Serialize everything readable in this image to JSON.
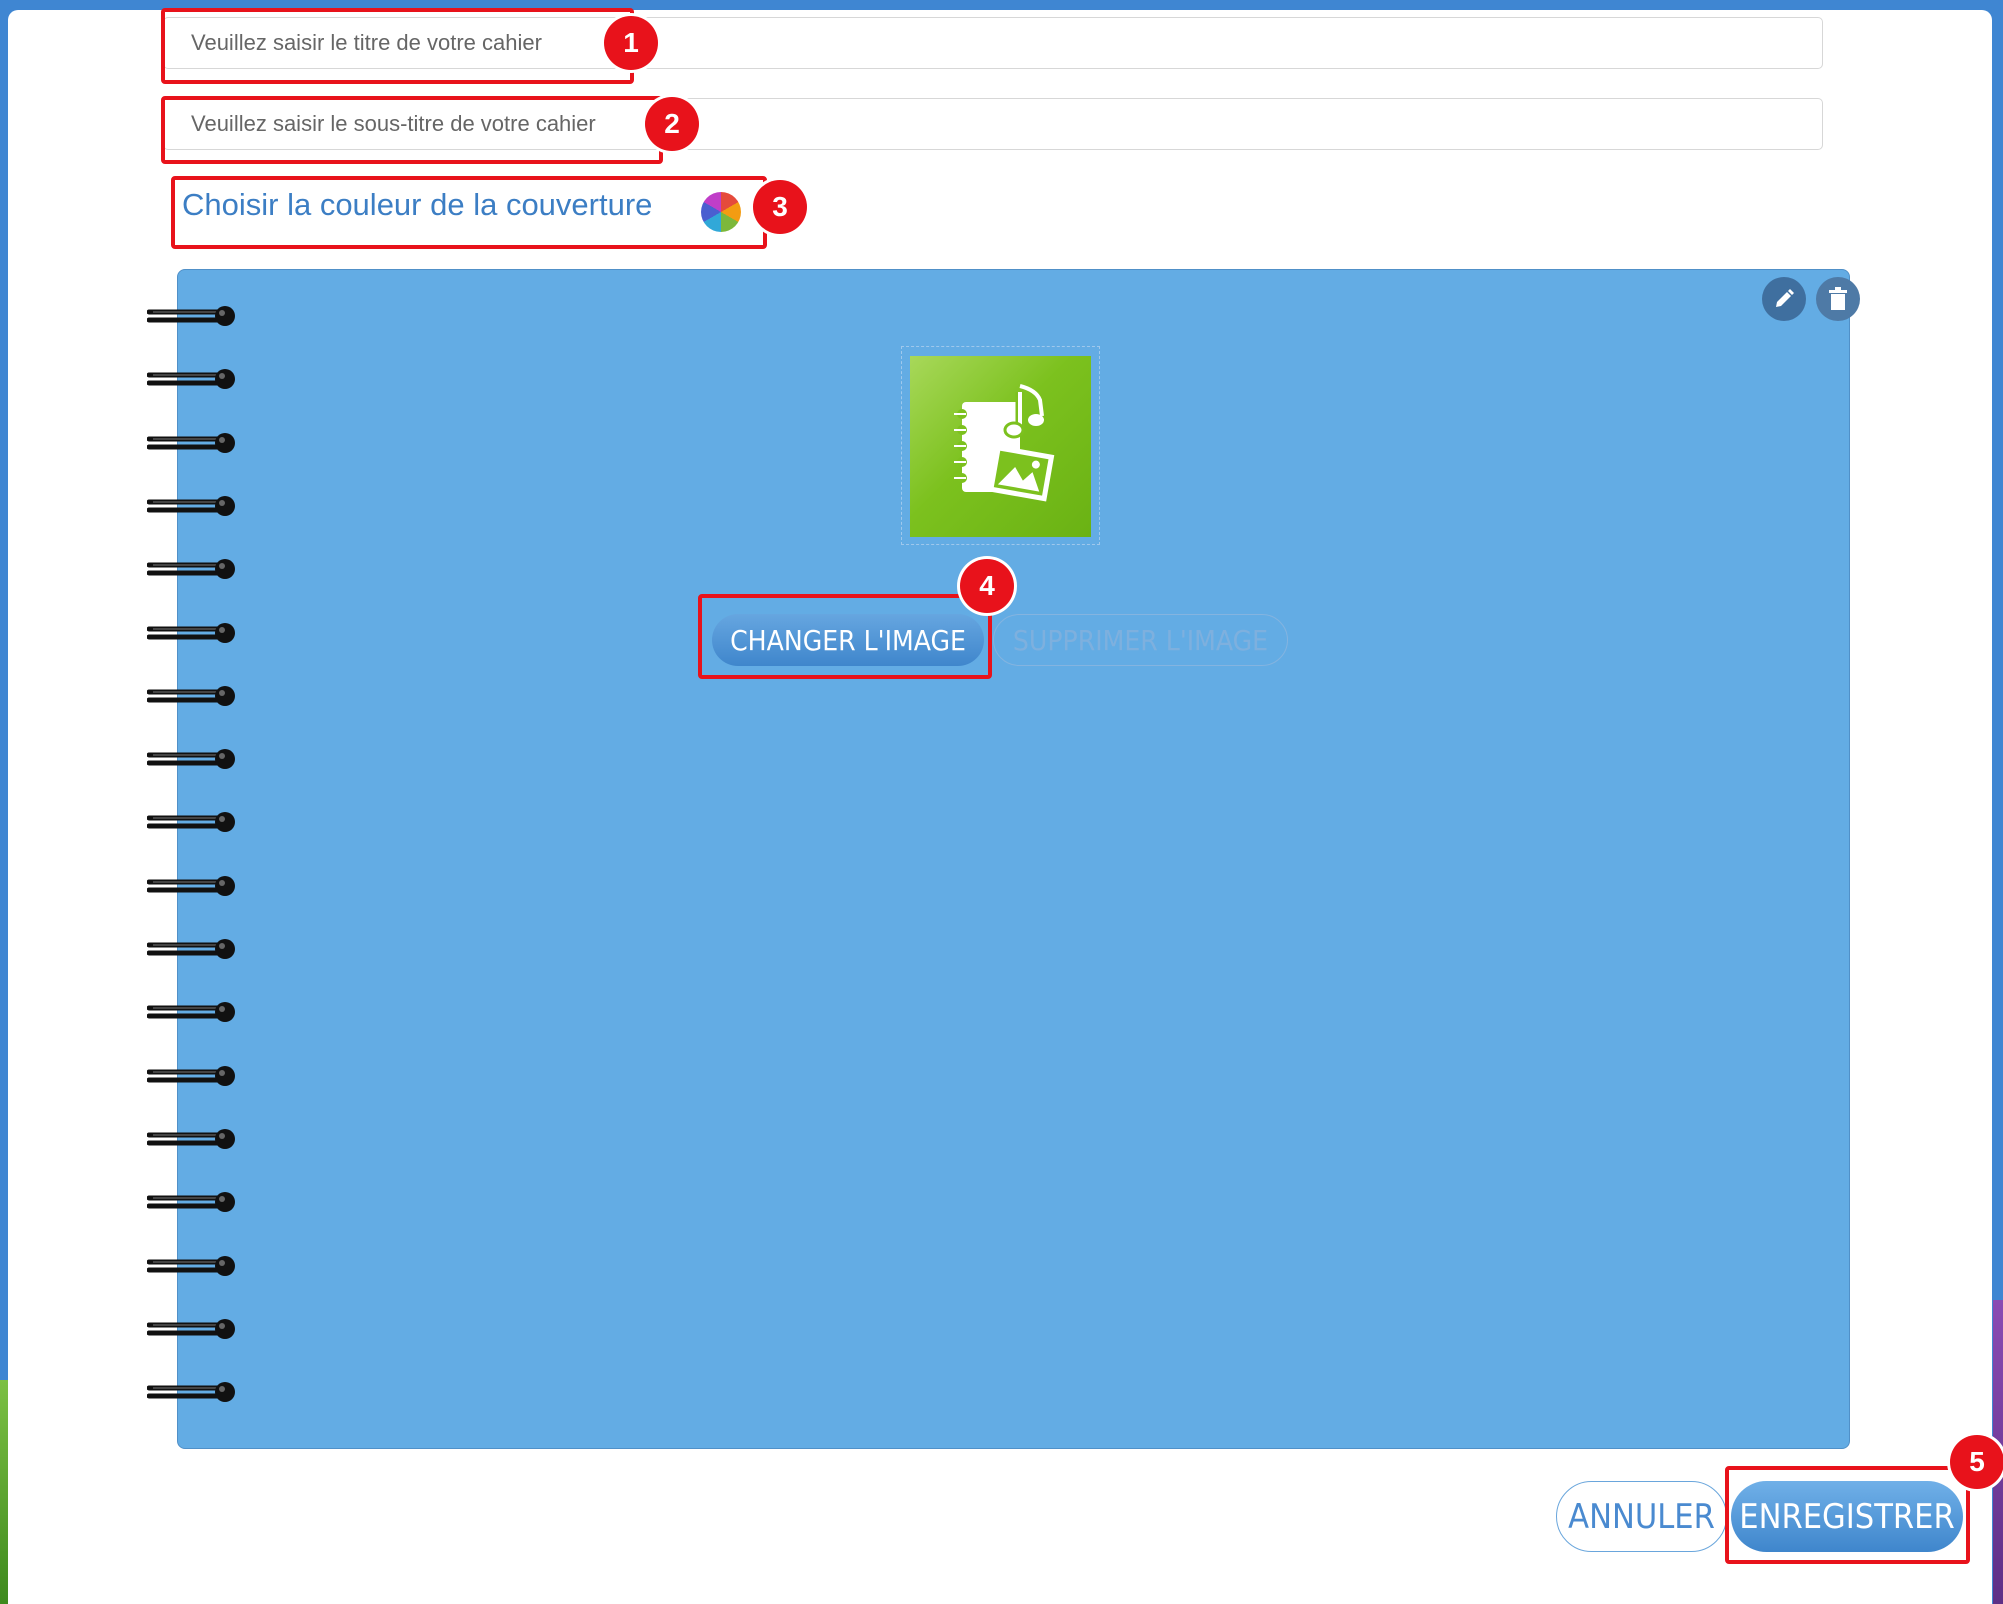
{
  "form": {
    "title_placeholder": "Veuillez saisir le titre de votre cahier",
    "subtitle_placeholder": "Veuillez saisir le sous-titre de votre cahier",
    "color_label": "Choisir la couleur de la couverture"
  },
  "cover": {
    "color": "#63ace4",
    "image_icon": "notebook-music-image-icon",
    "change_image_label": "CHANGER L'IMAGE",
    "delete_image_label": "SUPPRIMER L'IMAGE",
    "spiral_count": 18
  },
  "footer": {
    "cancel_label": "ANNULER",
    "save_label": "ENREGISTRER"
  },
  "annotations": [
    "1",
    "2",
    "3",
    "4",
    "5"
  ],
  "colors": {
    "highlight": "#e8121b",
    "accent": "#3c7ec4",
    "page_background": "#3f86d2"
  }
}
